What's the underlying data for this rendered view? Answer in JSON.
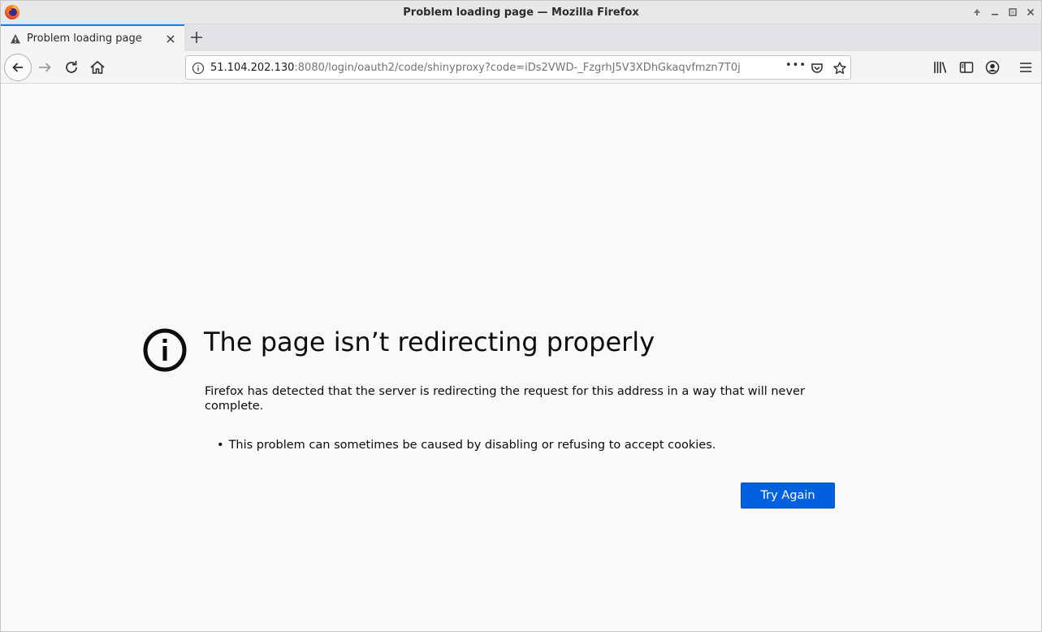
{
  "window": {
    "title": "Problem loading page — Mozilla Firefox",
    "controls": [
      "up-arrow-icon",
      "minimize-icon",
      "maximize-icon",
      "close-icon"
    ]
  },
  "tabs": [
    {
      "label": "Problem loading page",
      "icon": "warning-icon",
      "active": true
    }
  ],
  "navbar": {
    "url_host": "51.104.202.130",
    "url_rest": ":8080/login/oauth2/code/shinyproxy?code=iDs2VWD-_FzgrhJ5V3XDhGkaqvfmzn7T0j",
    "page_actions_label": "•••"
  },
  "error": {
    "title": "The page isn’t redirecting properly",
    "description": "Firefox has detected that the server is redirecting the request for this address in a way that will never complete.",
    "hints": [
      "This problem can sometimes be caused by disabling or refusing to accept cookies."
    ],
    "try_again_label": "Try Again"
  },
  "colors": {
    "accent": "#0a84ff",
    "button": "#0060df"
  }
}
